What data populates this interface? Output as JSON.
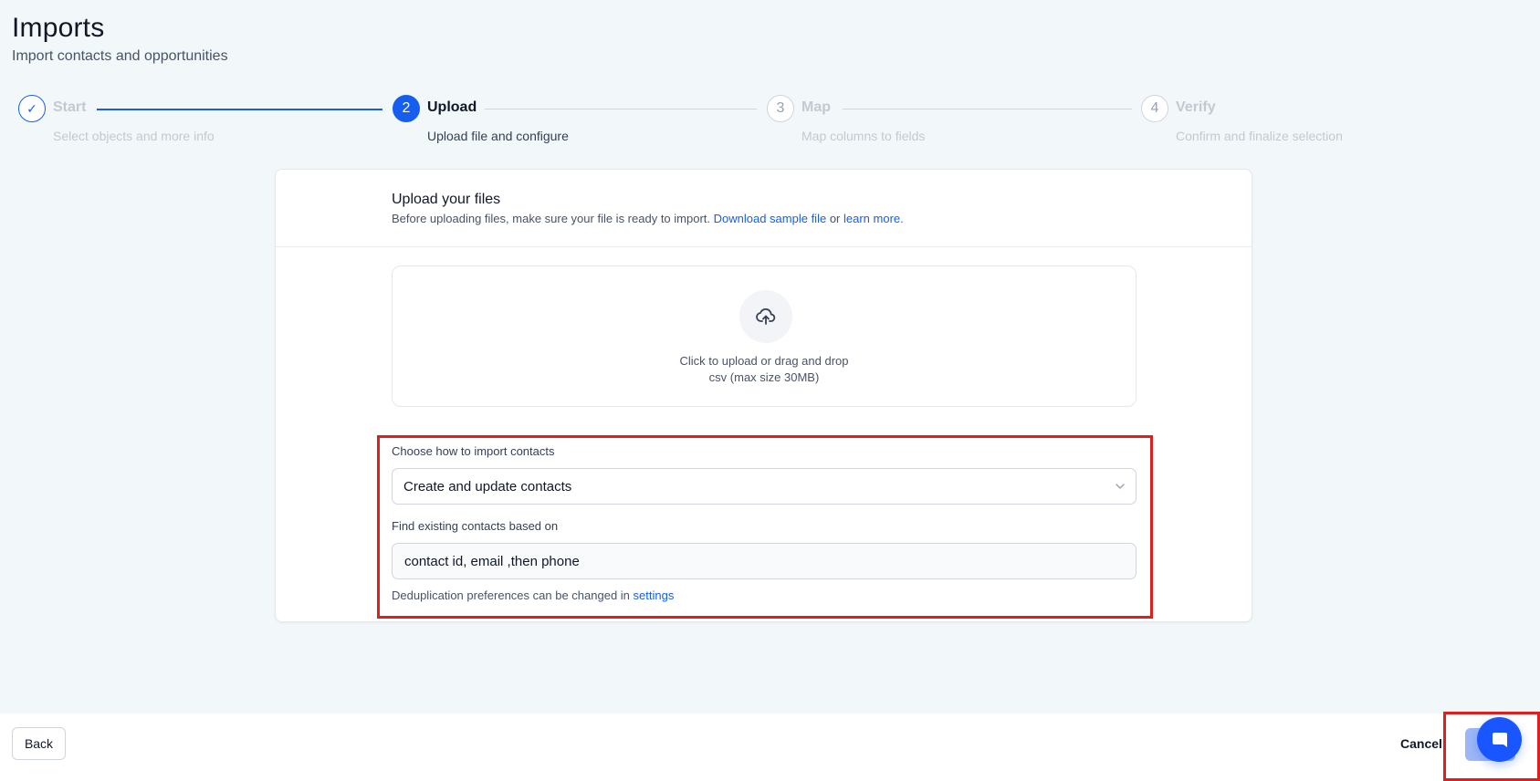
{
  "header": {
    "title": "Imports",
    "subtitle": "Import contacts and opportunities"
  },
  "stepper": {
    "steps": [
      {
        "marker": "✓",
        "label": "Start",
        "description": "Select objects and more info",
        "state": "done"
      },
      {
        "marker": "2",
        "label": "Upload",
        "description": "Upload file and configure",
        "state": "active"
      },
      {
        "marker": "3",
        "label": "Map",
        "description": "Map columns to fields",
        "state": "todo"
      },
      {
        "marker": "4",
        "label": "Verify",
        "description": "Confirm and finalize selection",
        "state": "todo"
      }
    ]
  },
  "upload_card": {
    "title": "Upload your files",
    "hint_prefix": "Before uploading files, make sure your file is ready to import. ",
    "sample_link": "Download sample file",
    "hint_or": " or ",
    "learn_link": "learn more.",
    "dropzone": {
      "icon": "upload-cloud-icon",
      "text": "Click to upload or drag and drop",
      "subtext": "csv (max size 30MB)"
    }
  },
  "import_settings": {
    "mode_label": "Choose how to import contacts",
    "mode_value": "Create and update contacts",
    "match_label": "Find existing contacts based on",
    "match_value": "contact id, email ,then phone",
    "note_prefix": "Deduplication preferences can be changed in ",
    "note_link": "settings"
  },
  "footer": {
    "back_label": "Back",
    "cancel_label": "Cancel",
    "chat_icon": "chat-bubble-icon"
  },
  "colors": {
    "primary": "#155eef",
    "highlight": "#e01e1e",
    "background": "#f2f7fa",
    "next_disabled": "#9db7f5"
  }
}
